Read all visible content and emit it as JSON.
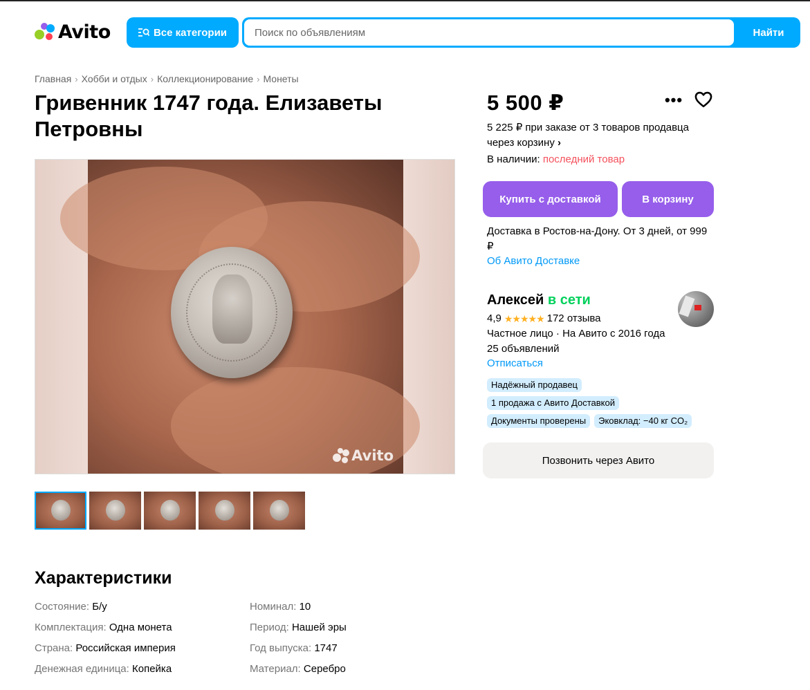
{
  "header": {
    "logo_text": "Avito",
    "categories_label": "Все категории",
    "search_placeholder": "Поиск по объявлениям",
    "search_button": "Найти"
  },
  "breadcrumb": [
    "Главная",
    "Хобби и отдых",
    "Коллекционирование",
    "Монеты"
  ],
  "listing": {
    "title": "Гривенник 1747 года. Елизаветы Петровны",
    "price": "5 500 ₽",
    "bulk_offer": "5 225 ₽ при заказе от 3 товаров продавца через корзину",
    "stock_label": "В наличии:",
    "stock_value": "последний товар",
    "buy_button": "Купить с доставкой",
    "cart_button": "В корзину",
    "delivery_text": "Доставка в Ростов-на-Дону. От 3 дней, от 999 ₽",
    "delivery_link": "Об Авито Доставке",
    "watermark": "Avito",
    "thumbnail_count": 5
  },
  "seller": {
    "name": "Алексей",
    "status": "в сети",
    "rating": "4,9",
    "stars": "★★★★★",
    "reviews": "172 отзыва",
    "info_line1": "Частное лицо · На Авито с 2016 года",
    "info_line2": "25 объявлений",
    "unsubscribe": "Отписаться",
    "badges": [
      "Надёжный продавец",
      "1 продажа с Авито Доставкой",
      "Документы проверены",
      "Эковклад: −40 кг CO₂"
    ],
    "call_button": "Позвонить через Авито"
  },
  "characteristics": {
    "title": "Характеристики",
    "items": [
      {
        "key": "Состояние:",
        "value": "Б/у"
      },
      {
        "key": "Номинал:",
        "value": "10"
      },
      {
        "key": "Комплектация:",
        "value": "Одна монета"
      },
      {
        "key": "Период:",
        "value": "Нашей эры"
      },
      {
        "key": "Страна:",
        "value": "Российская империя"
      },
      {
        "key": "Год выпуска:",
        "value": "1747"
      },
      {
        "key": "Денежная единица:",
        "value": "Копейка"
      },
      {
        "key": "Материал:",
        "value": "Серебро"
      }
    ]
  },
  "colors": {
    "accent_blue": "#00aaff",
    "purple": "#965eeb",
    "online_green": "#02d15c",
    "stock_red": "#f4515c",
    "link_blue": "#0099f7"
  }
}
